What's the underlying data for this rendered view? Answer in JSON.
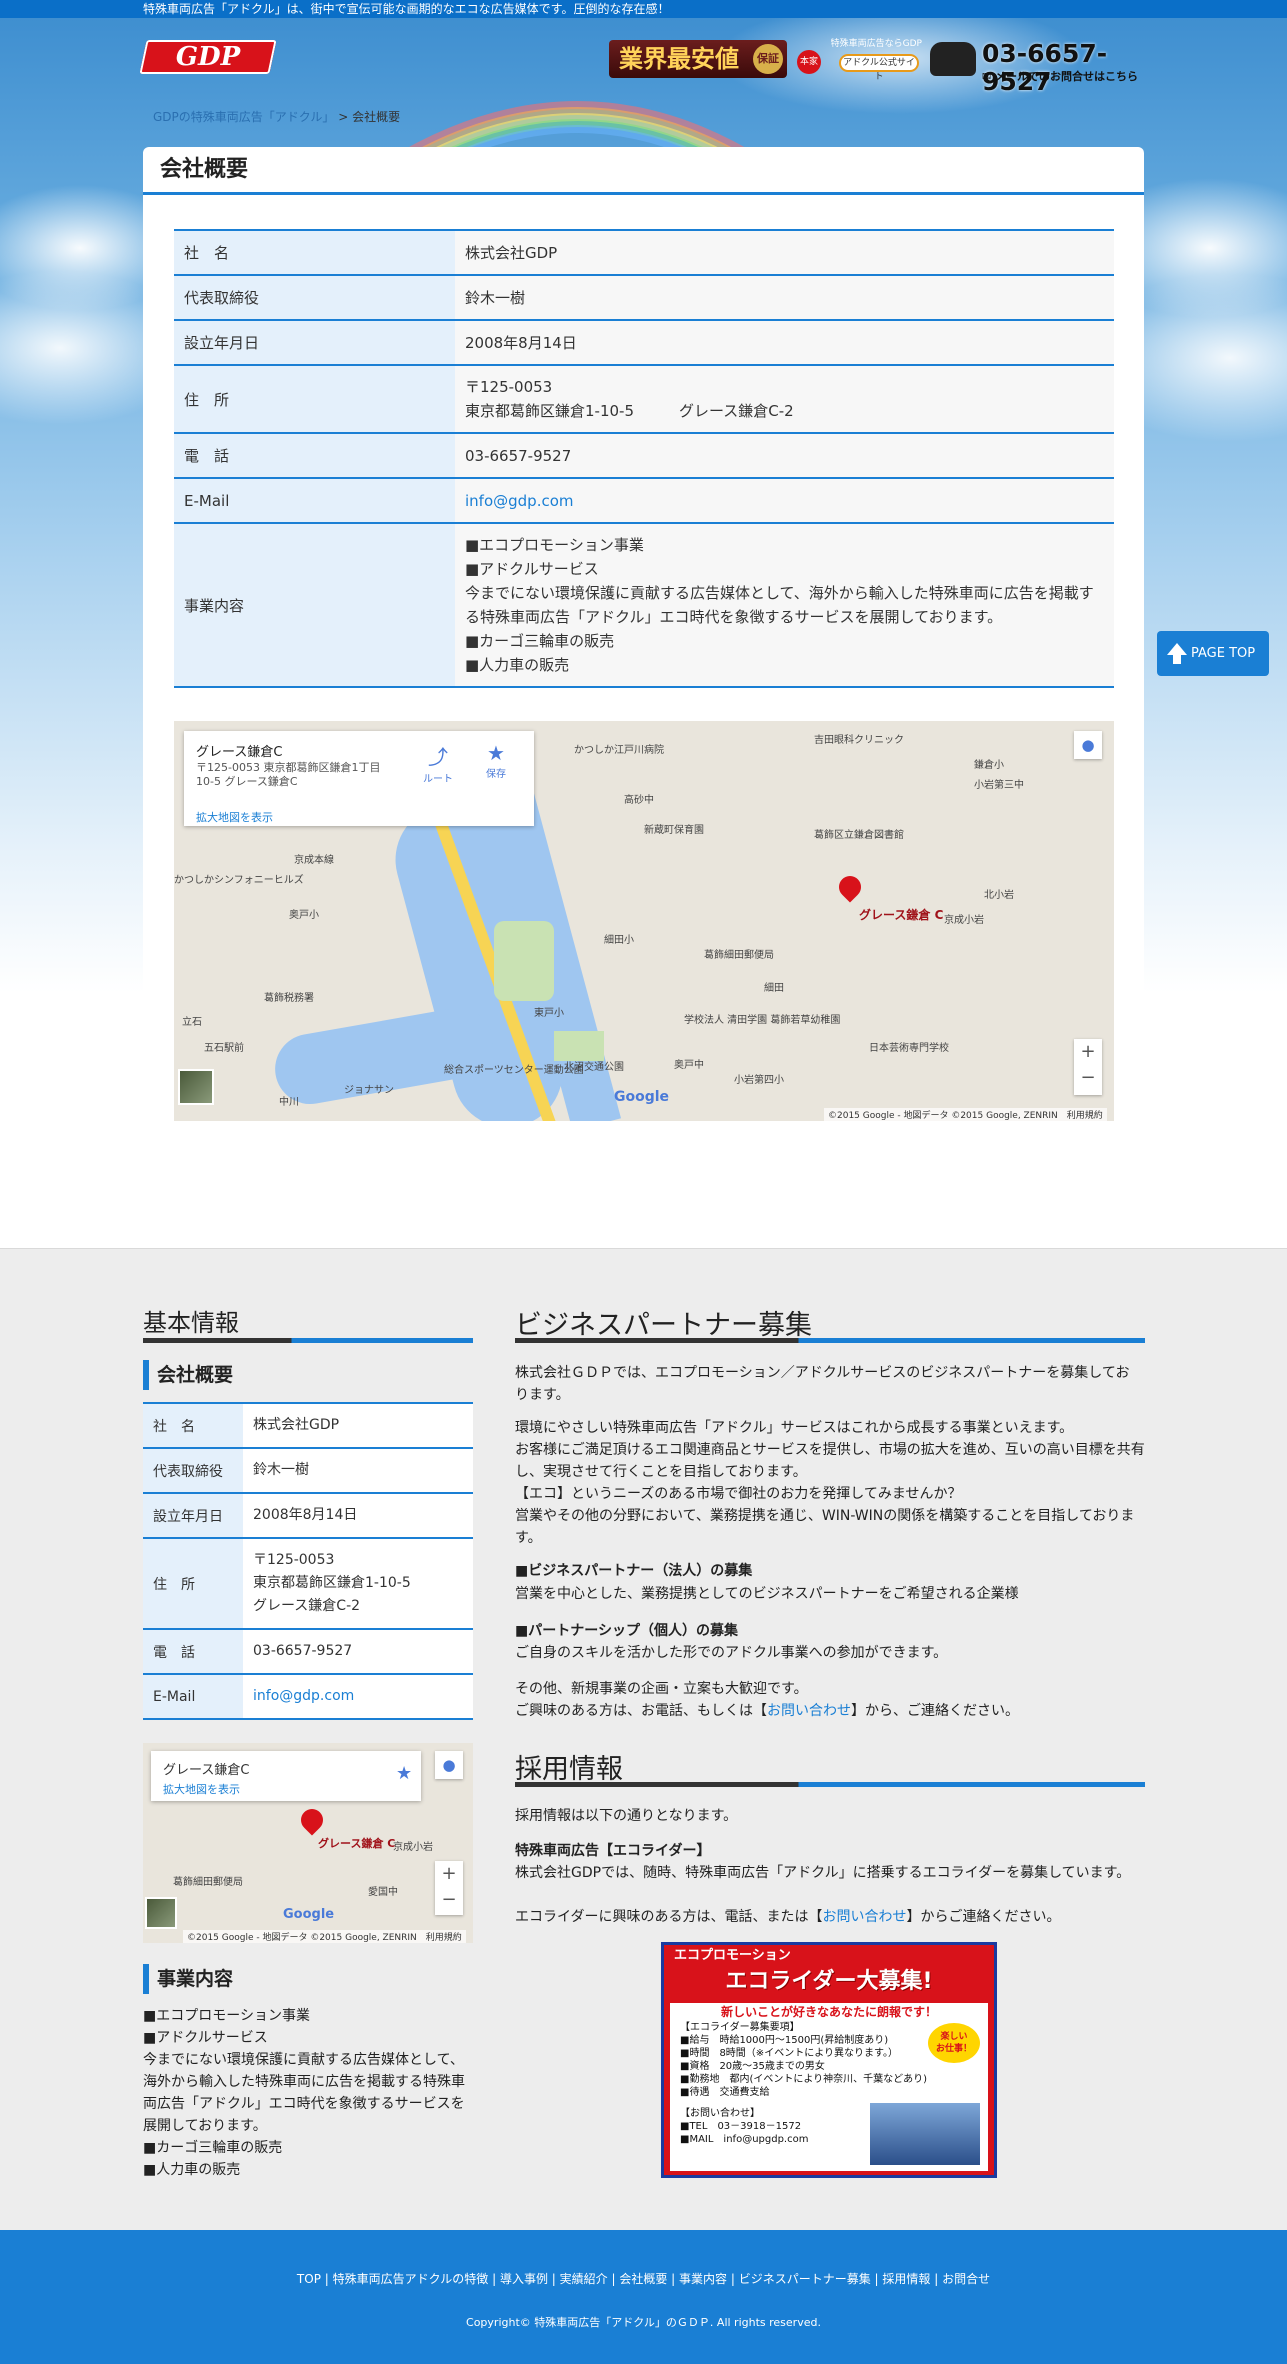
{
  "header": {
    "tagline": "特殊車両広告「アドクル」は、街中で宣伝可能な画期的なエコな広告媒体です。圧倒的な存在感！",
    "logo_text": "GDP",
    "badge_text": "業界最安値",
    "badge_seal": "保証",
    "mid_small": "特殊車両広告ならGDP",
    "mid_pill": "本家",
    "mid_pill2": "アドクル公式サイト",
    "phone": "03-6657-9527",
    "phone_note": "メールでのお問合せはこちら"
  },
  "breadcrumb": {
    "home": "GDPの特殊車両広告「アドクル」",
    "sep": ">",
    "current": "会社概要"
  },
  "page": {
    "title": "会社概要"
  },
  "company_table": [
    {
      "key": "社　名",
      "value": "株式会社GDP"
    },
    {
      "key": "代表取締役",
      "value": "鈴木一樹"
    },
    {
      "key": "設立年月日",
      "value": "2008年8月14日"
    },
    {
      "key": "住　所",
      "value": "〒125-0053\n東京都葛飾区鎌倉1-10-5　　　グレース鎌倉C-2"
    },
    {
      "key": "電　話",
      "value": "03-6657-9527"
    },
    {
      "key": "E-Mail",
      "value": "info@gdp.com"
    },
    {
      "key": "事業内容",
      "value": "■エコプロモーション事業\n■アドクルサービス\n今までにない環境保護に貢献する広告媒体として、海外から輸入した特殊車両に広告を掲載する特殊車両広告「アドクル」エコ時代を象徴するサービスを展開しております。\n■カーゴ三輪車の販売\n■人力車の販売"
    }
  ],
  "map_large": {
    "place_name": "グレース鎌倉C",
    "place_address": "〒125-0053 東京都葛飾区鎌倉1丁目10-5 グレース鎌倉C",
    "enlarge_link": "拡大地図を表示",
    "route_label": "ルート",
    "save_label": "保存",
    "pin_label": "グレース鎌倉 C",
    "credits": "©2015 Google - 地図データ ©2015 Google, ZENRIN　利用規約",
    "google": "Google",
    "labels": [
      "かつしか江戸川病院",
      "吉田眼科クリニック",
      "鎌倉小",
      "小岩第三中",
      "高砂中",
      "新蔵町保育園",
      "葛飾区立鎌倉図書館",
      "京成本線",
      "北小岩",
      "細田小",
      "葛飾細田郵便局",
      "京成小岩",
      "細田",
      "葛飾税務署",
      "東戸小",
      "学校法人 清田学園 葛飾若草幼稚園",
      "立石",
      "日本芸術専門学校",
      "五石駅前",
      "総合スポーツセンター運動公園",
      "北沼交通公園",
      "ジョナサン",
      "小岩第四小",
      "奥戸中",
      "中川",
      "かつしかシンフォニーヒルズ",
      "奥戸小"
    ]
  },
  "page_top": "PAGE TOP",
  "footer_info": {
    "heading": "基本情報",
    "sub_company": "会社概要",
    "rows": [
      {
        "key": "社　名",
        "value": "株式会社GDP"
      },
      {
        "key": "代表取締役",
        "value": "鈴木一樹"
      },
      {
        "key": "設立年月日",
        "value": "2008年8月14日"
      },
      {
        "key": "住　所",
        "value": "〒125-0053\n東京都葛飾区鎌倉1-10-5\nグレース鎌倉C-2"
      },
      {
        "key": "電　話",
        "value": "03-6657-9527"
      },
      {
        "key": "E-Mail",
        "value": "info@gdp.com"
      }
    ],
    "map_place": "グレース鎌倉C",
    "map_enlarge": "拡大地図を表示",
    "map_pin": "グレース鎌倉 C",
    "map_credits": "©2015 Google - 地図データ ©2015 Google, ZENRIN　利用規約",
    "map_labels": [
      "京成小岩",
      "葛飾細田郵便局",
      "愛国中"
    ],
    "sub_business": "事業内容",
    "business": "■エコプロモーション事業\n■アドクルサービス\n今までにない環境保護に貢献する広告媒体として、海外から輸入した特殊車両に広告を掲載する特殊車両広告「アドクル」エコ時代を象徴するサービスを展開しております。\n■カーゴ三輪車の販売\n■人力車の販売"
  },
  "partner": {
    "heading": "ビジネスパートナー募集",
    "p1": "株式会社ＧＤＰでは、エコプロモーション／アドクルサービスのビジネスパートナーを募集しております。",
    "p2": "環境にやさしい特殊車両広告「アドクル」サービスはこれから成長する事業といえます。\nお客様にご満足頂けるエコ関連商品とサービスを提供し、市場の拡大を進め、互いの高い目標を共有し、実現させて行くことを目指しております。\n【エコ】というニーズのある市場で御社のお力を発揮してみませんか？\n営業やその他の分野において、業務提携を通じ、WIN-WINの関係を構築することを目指しております。",
    "h_corp": "■ビジネスパートナー（法人）の募集",
    "corp": "営業を中心とした、業務提携としてのビジネスパートナーをご希望される企業様",
    "h_indiv": "■パートナーシップ（個人）の募集",
    "indiv": "ご自身のスキルを活かした形でのアドクル事業への参加ができます。",
    "p3a": "その他、新規事業の企画・立案も大歓迎です。",
    "p3b_pre": "ご興味のある方は、お電話、もしくは【",
    "p3b_link": "お問い合わせ",
    "p3b_post": "】から、ご連絡ください。"
  },
  "recruit": {
    "heading": "採用情報",
    "intro": "採用情報は以下の通りとなります。",
    "h": "特殊車両広告【エコライダー】",
    "p1": "株式会社GDPでは、随時、特殊車両広告「アドクル」に搭乗するエコライダーを募集しています。",
    "p2_pre": "エコライダーに興味のある方は、電話、または【",
    "p2_link": "お問い合わせ",
    "p2_post": "】からご連絡ください。",
    "banner_head": "エコプロモーション",
    "banner_big": "エコライダー大募集!",
    "banner_catch": "新しいことが好きなあなたに朗報です！",
    "banner_star": "楽しい\nお仕事！",
    "banner_lines": [
      "【エコライダー募集要項】",
      "■給与　時給1000円～1500円(昇給制度あり)",
      "■時間　8時間（※イベントにより異なります。）",
      "■資格　20歳～35歳までの男女",
      "■勤務地　都内(イベントにより神奈川、千葉などあり)",
      "■待遇　交通費支給",
      "",
      "【お問い合わせ】",
      "■TEL　03－3918－1572",
      "■MAIL　info@upgdp.com"
    ]
  },
  "footer": {
    "nav": [
      "TOP",
      "特殊車両広告アドクルの特徴",
      "導入事例",
      "実績紹介",
      "会社概要",
      "事業内容",
      "ビジネスパートナー募集",
      "採用情報",
      "お問合せ"
    ],
    "copyright": "Copyright© 特殊車両広告「アドクル」のＧＤＰ. All rights reserved."
  },
  "colors": {
    "accent": "#1a7fd4",
    "brand_red": "#d8121a",
    "table_key_bg": "#e4f0fb"
  }
}
